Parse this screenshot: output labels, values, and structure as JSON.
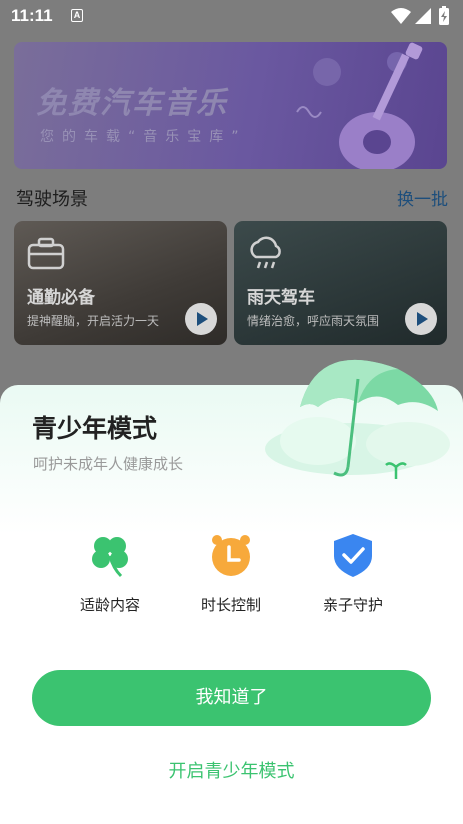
{
  "status_bar": {
    "time": "11:11",
    "notification_icon": "a-letter-icon",
    "icons": [
      "wifi-icon",
      "signal-icon",
      "battery-charging-icon"
    ]
  },
  "background": {
    "banner": {
      "title": "免费汽车音乐",
      "subtitle": "您的车载“音乐宝库”"
    },
    "section": {
      "title": "驾驶场景",
      "more_label": "换一批"
    },
    "scenes": [
      {
        "name": "通勤必备",
        "desc": "提神醒脑，开启活力一天",
        "icon": "briefcase-icon"
      },
      {
        "name": "雨天驾车",
        "desc": "情绪治愈，呼应雨天氛围",
        "icon": "rain-cloud-icon"
      }
    ]
  },
  "sheet": {
    "title": "青少年模式",
    "subtitle": "呵护未成年人健康成长",
    "features": [
      {
        "label": "适龄内容",
        "icon": "clover-icon",
        "color": "#3bc370"
      },
      {
        "label": "时长控制",
        "icon": "alarm-clock-icon",
        "color": "#f7a93b"
      },
      {
        "label": "亲子守护",
        "icon": "shield-check-icon",
        "color": "#3a86f0"
      }
    ],
    "primary_button": "我知道了",
    "secondary_link": "开启青少年模式"
  },
  "colors": {
    "accent_green": "#3bc370",
    "scrim": "#7d7d7d"
  }
}
